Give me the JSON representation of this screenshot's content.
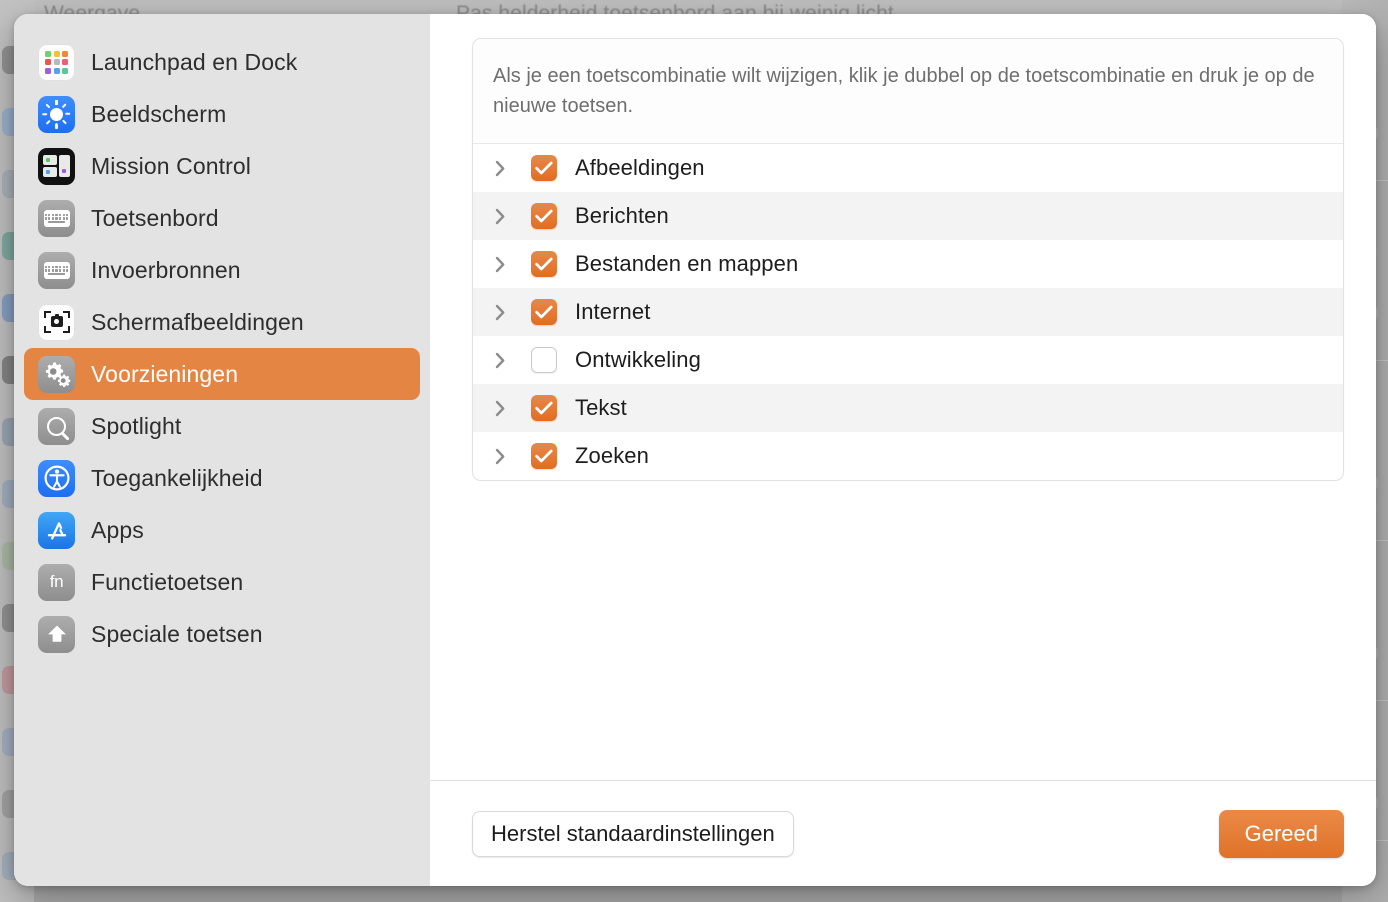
{
  "background": {
    "title_left": "Weergave",
    "title_right": "Pas helderheid toetsenbord aan bij weinig licht"
  },
  "colors": {
    "accent_orange": "#e58544",
    "checkbox_orange": "#e0701f",
    "sidebar_bg": "#e3e3e3",
    "row_alt": "#f3f3f3"
  },
  "sidebar": {
    "items": [
      {
        "label": "Launchpad en Dock",
        "icon": "launchpad-icon",
        "selected": false
      },
      {
        "label": "Beeldscherm",
        "icon": "brightness-icon",
        "selected": false
      },
      {
        "label": "Mission Control",
        "icon": "mission-control-icon",
        "selected": false
      },
      {
        "label": "Toetsenbord",
        "icon": "keyboard-icon",
        "selected": false
      },
      {
        "label": "Invoerbronnen",
        "icon": "keyboard-icon",
        "selected": false
      },
      {
        "label": "Schermafbeeldingen",
        "icon": "screenshot-icon",
        "selected": false
      },
      {
        "label": "Voorzieningen",
        "icon": "gears-icon",
        "selected": true
      },
      {
        "label": "Spotlight",
        "icon": "search-icon",
        "selected": false
      },
      {
        "label": "Toegankelijkheid",
        "icon": "accessibility-icon",
        "selected": false
      },
      {
        "label": "Apps",
        "icon": "app-store-icon",
        "selected": false
      },
      {
        "label": "Functietoetsen",
        "icon": "fn-key-icon",
        "selected": false
      },
      {
        "label": "Speciale toetsen",
        "icon": "shift-arrow-icon",
        "selected": false
      }
    ]
  },
  "main": {
    "description": "Als je een toetscombinatie wilt wijzigen, klik je dubbel op de toetscombinatie en druk je op de nieuwe toetsen.",
    "rows": [
      {
        "label": "Afbeeldingen",
        "checked": true
      },
      {
        "label": "Berichten",
        "checked": true
      },
      {
        "label": "Bestanden en mappen",
        "checked": true
      },
      {
        "label": "Internet",
        "checked": true
      },
      {
        "label": "Ontwikkeling",
        "checked": false
      },
      {
        "label": "Tekst",
        "checked": true
      },
      {
        "label": "Zoeken",
        "checked": true
      }
    ]
  },
  "footer": {
    "reset_label": "Herstel standaardinstellingen",
    "done_label": "Gereed"
  }
}
